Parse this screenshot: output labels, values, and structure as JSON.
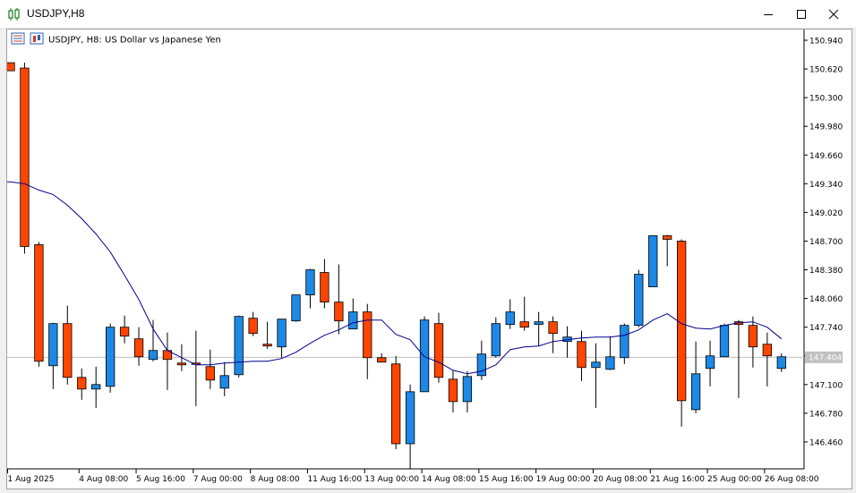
{
  "window": {
    "title": "USDJPY,H8",
    "controls": {
      "minimize": "minimize",
      "maximize": "maximize",
      "close": "close"
    }
  },
  "chart_header": "USDJPY, H8:  US Dollar vs Japanese Yen",
  "colors": {
    "bull": "#1e88e5",
    "bear": "#ff4500",
    "wick": "#000000",
    "ma": "#00008b",
    "price_line": "#c0c0c0",
    "price_label_bg": "#c0c0c0"
  },
  "current_price": "147.404",
  "chart_data": {
    "type": "candlestick",
    "symbol": "USDJPY",
    "timeframe": "H8",
    "y_ticks": [
      "150.940",
      "150.620",
      "150.300",
      "149.980",
      "149.660",
      "149.340",
      "149.020",
      "148.700",
      "148.380",
      "148.060",
      "147.740",
      "147.420",
      "147.100",
      "146.780",
      "146.460"
    ],
    "ylim": [
      146.16,
      150.98
    ],
    "x_ticks": [
      {
        "index": 0,
        "label": "1 Aug 2025"
      },
      {
        "index": 5,
        "label": "4 Aug 08:00"
      },
      {
        "index": 9,
        "label": "5 Aug 16:00"
      },
      {
        "index": 13,
        "label": "7 Aug 00:00"
      },
      {
        "index": 17,
        "label": "8 Aug 08:00"
      },
      {
        "index": 21,
        "label": "11 Aug 16:00"
      },
      {
        "index": 25,
        "label": "13 Aug 00:00"
      },
      {
        "index": 29,
        "label": "14 Aug 08:00"
      },
      {
        "index": 33,
        "label": "15 Aug 16:00"
      },
      {
        "index": 37,
        "label": "19 Aug 00:00"
      },
      {
        "index": 41,
        "label": "20 Aug 08:00"
      },
      {
        "index": 45,
        "label": "21 Aug 16:00"
      },
      {
        "index": 49,
        "label": "25 Aug 00:00"
      },
      {
        "index": 53,
        "label": "26 Aug 08:00"
      }
    ],
    "candles": [
      {
        "o": 150.69,
        "h": 150.69,
        "l": 150.6,
        "c": 150.6
      },
      {
        "o": 150.63,
        "h": 150.69,
        "l": 148.56,
        "c": 148.64
      },
      {
        "o": 148.66,
        "h": 148.69,
        "l": 147.3,
        "c": 147.36
      },
      {
        "o": 147.31,
        "h": 147.79,
        "l": 147.05,
        "c": 147.78
      },
      {
        "o": 147.78,
        "h": 147.98,
        "l": 147.1,
        "c": 147.18
      },
      {
        "o": 147.18,
        "h": 147.28,
        "l": 146.93,
        "c": 147.05
      },
      {
        "o": 147.05,
        "h": 147.3,
        "l": 146.84,
        "c": 147.1
      },
      {
        "o": 147.08,
        "h": 147.78,
        "l": 147.01,
        "c": 147.74
      },
      {
        "o": 147.74,
        "h": 147.87,
        "l": 147.56,
        "c": 147.64
      },
      {
        "o": 147.61,
        "h": 147.74,
        "l": 147.31,
        "c": 147.41
      },
      {
        "o": 147.38,
        "h": 147.82,
        "l": 147.36,
        "c": 147.48
      },
      {
        "o": 147.48,
        "h": 147.68,
        "l": 147.04,
        "c": 147.38
      },
      {
        "o": 147.34,
        "h": 147.55,
        "l": 147.25,
        "c": 147.32
      },
      {
        "o": 147.34,
        "h": 147.7,
        "l": 146.86,
        "c": 147.33
      },
      {
        "o": 147.3,
        "h": 147.49,
        "l": 147.05,
        "c": 147.15
      },
      {
        "o": 147.06,
        "h": 147.35,
        "l": 146.97,
        "c": 147.2
      },
      {
        "o": 147.21,
        "h": 147.87,
        "l": 147.18,
        "c": 147.86
      },
      {
        "o": 147.84,
        "h": 147.91,
        "l": 147.64,
        "c": 147.67
      },
      {
        "o": 147.55,
        "h": 147.8,
        "l": 147.5,
        "c": 147.53
      },
      {
        "o": 147.52,
        "h": 147.82,
        "l": 147.4,
        "c": 147.83
      },
      {
        "o": 147.81,
        "h": 148.09,
        "l": 147.8,
        "c": 148.1
      },
      {
        "o": 148.1,
        "h": 148.39,
        "l": 147.95,
        "c": 148.38
      },
      {
        "o": 148.35,
        "h": 148.5,
        "l": 147.95,
        "c": 148.02
      },
      {
        "o": 148.02,
        "h": 148.44,
        "l": 147.66,
        "c": 147.81
      },
      {
        "o": 147.72,
        "h": 148.06,
        "l": 147.72,
        "c": 147.91
      },
      {
        "o": 147.91,
        "h": 148.0,
        "l": 147.16,
        "c": 147.4
      },
      {
        "o": 147.4,
        "h": 147.45,
        "l": 147.38,
        "c": 147.35
      },
      {
        "o": 147.33,
        "h": 147.42,
        "l": 146.38,
        "c": 146.44
      },
      {
        "o": 146.44,
        "h": 147.1,
        "l": 146.16,
        "c": 147.02
      },
      {
        "o": 147.02,
        "h": 147.86,
        "l": 147.02,
        "c": 147.82
      },
      {
        "o": 147.78,
        "h": 147.9,
        "l": 147.12,
        "c": 147.18
      },
      {
        "o": 147.16,
        "h": 147.26,
        "l": 146.79,
        "c": 146.91
      },
      {
        "o": 146.91,
        "h": 147.25,
        "l": 146.79,
        "c": 147.19
      },
      {
        "o": 147.2,
        "h": 147.59,
        "l": 147.15,
        "c": 147.44
      },
      {
        "o": 147.42,
        "h": 147.85,
        "l": 147.4,
        "c": 147.78
      },
      {
        "o": 147.77,
        "h": 148.05,
        "l": 147.72,
        "c": 147.91
      },
      {
        "o": 147.8,
        "h": 148.08,
        "l": 147.7,
        "c": 147.74
      },
      {
        "o": 147.77,
        "h": 147.91,
        "l": 147.53,
        "c": 147.8
      },
      {
        "o": 147.8,
        "h": 147.86,
        "l": 147.45,
        "c": 147.67
      },
      {
        "o": 147.58,
        "h": 147.75,
        "l": 147.4,
        "c": 147.63
      },
      {
        "o": 147.58,
        "h": 147.7,
        "l": 147.14,
        "c": 147.29
      },
      {
        "o": 147.29,
        "h": 147.56,
        "l": 146.84,
        "c": 147.35
      },
      {
        "o": 147.27,
        "h": 147.64,
        "l": 147.26,
        "c": 147.41
      },
      {
        "o": 147.4,
        "h": 147.78,
        "l": 147.33,
        "c": 147.76
      },
      {
        "o": 147.76,
        "h": 148.38,
        "l": 147.74,
        "c": 148.33
      },
      {
        "o": 148.19,
        "h": 148.76,
        "l": 148.19,
        "c": 148.76
      },
      {
        "o": 148.76,
        "h": 148.77,
        "l": 148.42,
        "c": 148.72
      },
      {
        "o": 148.7,
        "h": 148.72,
        "l": 146.63,
        "c": 146.92
      },
      {
        "o": 146.82,
        "h": 147.58,
        "l": 146.78,
        "c": 147.22
      },
      {
        "o": 147.28,
        "h": 147.59,
        "l": 147.08,
        "c": 147.42
      },
      {
        "o": 147.41,
        "h": 147.78,
        "l": 147.41,
        "c": 147.76
      },
      {
        "o": 147.8,
        "h": 147.82,
        "l": 146.95,
        "c": 147.77
      },
      {
        "o": 147.76,
        "h": 147.86,
        "l": 147.29,
        "c": 147.52
      },
      {
        "o": 147.55,
        "h": 147.68,
        "l": 147.08,
        "c": 147.42
      },
      {
        "o": 147.28,
        "h": 147.45,
        "l": 147.24,
        "c": 147.41
      }
    ],
    "moving_average": [
      149.36,
      149.36,
      149.34,
      149.27,
      149.22,
      149.1,
      148.95,
      148.78,
      148.58,
      148.32,
      148.05,
      147.72,
      147.48,
      147.4,
      147.32,
      147.32,
      147.34,
      147.35,
      147.36,
      147.36,
      147.39,
      147.46,
      147.56,
      147.65,
      147.71,
      147.79,
      147.82,
      147.82,
      147.66,
      147.6,
      147.41,
      147.35,
      147.26,
      147.22,
      147.25,
      147.32,
      147.49,
      147.52,
      147.53,
      147.58,
      147.6,
      147.62,
      147.63,
      147.63,
      147.65,
      147.71,
      147.82,
      147.89,
      147.78,
      147.73,
      147.72,
      147.76,
      147.79,
      147.8,
      147.74,
      147.61
    ],
    "ma_x_offset": -1
  }
}
